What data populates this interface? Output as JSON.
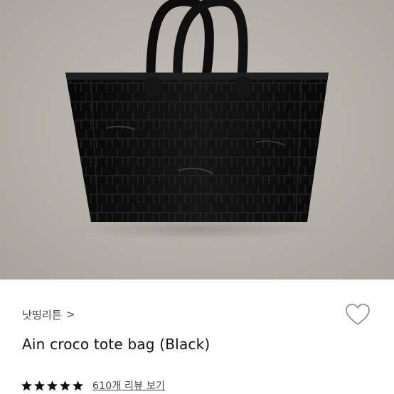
{
  "product": {
    "brand": "낫띵리튼",
    "brand_chevron": ">",
    "title": "Ain croco tote bag (Black)",
    "rating": 5,
    "rating_max": 5,
    "reviews_label": "610개 리뷰 보기"
  },
  "icons": {
    "brand_chevron": "chevron-right-icon",
    "wishlist": "heart-outline-icon",
    "rating": "star-icon"
  },
  "colors": {
    "star": "#111111",
    "heart_stroke": "#888888",
    "photo_background": "#b6b1aa",
    "bag": "#0e0e0e"
  }
}
